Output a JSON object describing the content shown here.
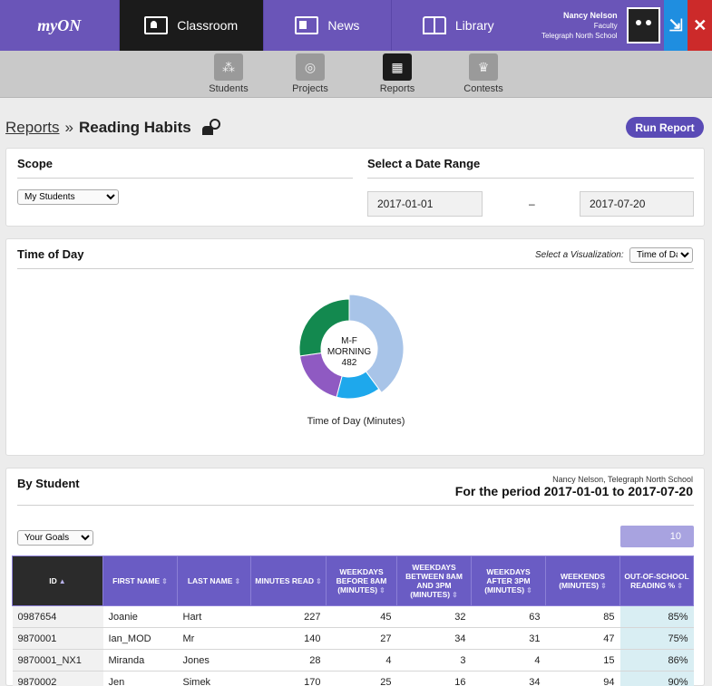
{
  "app": {
    "logo": "myON",
    "nav": [
      {
        "label": "Classroom",
        "icon": "classroom-icon"
      },
      {
        "label": "News",
        "icon": "news-icon"
      },
      {
        "label": "Library",
        "icon": "library-icon"
      }
    ],
    "user": {
      "name": "Nancy Nelson",
      "role": "Faculty",
      "school": "Telegraph North School"
    }
  },
  "subnav": {
    "items": [
      {
        "label": "Students",
        "icon": "students-icon"
      },
      {
        "label": "Projects",
        "icon": "projects-icon"
      },
      {
        "label": "Reports",
        "icon": "reports-icon"
      },
      {
        "label": "Contests",
        "icon": "trophy-icon"
      }
    ],
    "active": "Reports"
  },
  "breadcrumb": {
    "parent": "Reports",
    "separator": "»",
    "current": "Reading Habits"
  },
  "run_report_label": "Run Report",
  "scope": {
    "title": "Scope",
    "selected": "My Students"
  },
  "date_range": {
    "title": "Select a Date Range",
    "start": "2017-01-01",
    "dash": "–",
    "end": "2017-07-20"
  },
  "time_of_day": {
    "title": "Time of Day",
    "vis_label": "Select a Visualization:",
    "vis_selected": "Time of Day",
    "center_line1": "M-F",
    "center_line2": "MORNING",
    "center_value": "482",
    "caption": "Time of Day (Minutes)"
  },
  "chart_data": {
    "type": "pie",
    "slices": [
      {
        "value": 482,
        "color": "#a8c4e8"
      },
      {
        "value": 172,
        "color": "#1ea8ec"
      },
      {
        "value": 225,
        "color": "#8f5ac2"
      },
      {
        "value": 330,
        "color": "#13894f"
      }
    ]
  },
  "by_student": {
    "title": "By Student",
    "info_line1": "Nancy Nelson, Telegraph North School",
    "info_line2": "For the period 2017-01-01 to 2017-07-20",
    "goal_selected": "Your Goals",
    "page_size": "10"
  },
  "table": {
    "headers": [
      "ID",
      "FIRST NAME",
      "LAST NAME",
      "MINUTES READ",
      "WEEKDAYS BEFORE 8AM (MINUTES)",
      "WEEKDAYS BETWEEN 8AM AND 3PM (MINUTES)",
      "WEEKDAYS AFTER 3PM (MINUTES)",
      "WEEKENDS (MINUTES)",
      "OUT-OF-SCHOOL READING %"
    ],
    "rows": [
      [
        "0987654",
        "Joanie",
        "Hart",
        "227",
        "45",
        "32",
        "63",
        "85",
        "85%"
      ],
      [
        "9870001",
        "Ian_MOD",
        "Mr",
        "140",
        "27",
        "34",
        "31",
        "47",
        "75%"
      ],
      [
        "9870001_NX1",
        "Miranda",
        "Jones",
        "28",
        "4",
        "3",
        "4",
        "15",
        "86%"
      ],
      [
        "9870002",
        "Jen",
        "Simek",
        "170",
        "25",
        "16",
        "34",
        "94",
        "90%"
      ]
    ]
  }
}
